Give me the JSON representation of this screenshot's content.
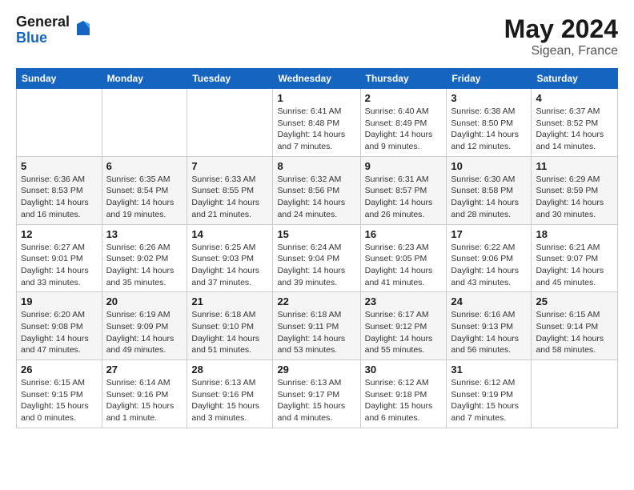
{
  "logo": {
    "general": "General",
    "blue": "Blue"
  },
  "header": {
    "month": "May 2024",
    "location": "Sigean, France"
  },
  "weekdays": [
    "Sunday",
    "Monday",
    "Tuesday",
    "Wednesday",
    "Thursday",
    "Friday",
    "Saturday"
  ],
  "weeks": [
    [
      {
        "day": "",
        "info": ""
      },
      {
        "day": "",
        "info": ""
      },
      {
        "day": "",
        "info": ""
      },
      {
        "day": "1",
        "info": "Sunrise: 6:41 AM\nSunset: 8:48 PM\nDaylight: 14 hours\nand 7 minutes."
      },
      {
        "day": "2",
        "info": "Sunrise: 6:40 AM\nSunset: 8:49 PM\nDaylight: 14 hours\nand 9 minutes."
      },
      {
        "day": "3",
        "info": "Sunrise: 6:38 AM\nSunset: 8:50 PM\nDaylight: 14 hours\nand 12 minutes."
      },
      {
        "day": "4",
        "info": "Sunrise: 6:37 AM\nSunset: 8:52 PM\nDaylight: 14 hours\nand 14 minutes."
      }
    ],
    [
      {
        "day": "5",
        "info": "Sunrise: 6:36 AM\nSunset: 8:53 PM\nDaylight: 14 hours\nand 16 minutes."
      },
      {
        "day": "6",
        "info": "Sunrise: 6:35 AM\nSunset: 8:54 PM\nDaylight: 14 hours\nand 19 minutes."
      },
      {
        "day": "7",
        "info": "Sunrise: 6:33 AM\nSunset: 8:55 PM\nDaylight: 14 hours\nand 21 minutes."
      },
      {
        "day": "8",
        "info": "Sunrise: 6:32 AM\nSunset: 8:56 PM\nDaylight: 14 hours\nand 24 minutes."
      },
      {
        "day": "9",
        "info": "Sunrise: 6:31 AM\nSunset: 8:57 PM\nDaylight: 14 hours\nand 26 minutes."
      },
      {
        "day": "10",
        "info": "Sunrise: 6:30 AM\nSunset: 8:58 PM\nDaylight: 14 hours\nand 28 minutes."
      },
      {
        "day": "11",
        "info": "Sunrise: 6:29 AM\nSunset: 8:59 PM\nDaylight: 14 hours\nand 30 minutes."
      }
    ],
    [
      {
        "day": "12",
        "info": "Sunrise: 6:27 AM\nSunset: 9:01 PM\nDaylight: 14 hours\nand 33 minutes."
      },
      {
        "day": "13",
        "info": "Sunrise: 6:26 AM\nSunset: 9:02 PM\nDaylight: 14 hours\nand 35 minutes."
      },
      {
        "day": "14",
        "info": "Sunrise: 6:25 AM\nSunset: 9:03 PM\nDaylight: 14 hours\nand 37 minutes."
      },
      {
        "day": "15",
        "info": "Sunrise: 6:24 AM\nSunset: 9:04 PM\nDaylight: 14 hours\nand 39 minutes."
      },
      {
        "day": "16",
        "info": "Sunrise: 6:23 AM\nSunset: 9:05 PM\nDaylight: 14 hours\nand 41 minutes."
      },
      {
        "day": "17",
        "info": "Sunrise: 6:22 AM\nSunset: 9:06 PM\nDaylight: 14 hours\nand 43 minutes."
      },
      {
        "day": "18",
        "info": "Sunrise: 6:21 AM\nSunset: 9:07 PM\nDaylight: 14 hours\nand 45 minutes."
      }
    ],
    [
      {
        "day": "19",
        "info": "Sunrise: 6:20 AM\nSunset: 9:08 PM\nDaylight: 14 hours\nand 47 minutes."
      },
      {
        "day": "20",
        "info": "Sunrise: 6:19 AM\nSunset: 9:09 PM\nDaylight: 14 hours\nand 49 minutes."
      },
      {
        "day": "21",
        "info": "Sunrise: 6:18 AM\nSunset: 9:10 PM\nDaylight: 14 hours\nand 51 minutes."
      },
      {
        "day": "22",
        "info": "Sunrise: 6:18 AM\nSunset: 9:11 PM\nDaylight: 14 hours\nand 53 minutes."
      },
      {
        "day": "23",
        "info": "Sunrise: 6:17 AM\nSunset: 9:12 PM\nDaylight: 14 hours\nand 55 minutes."
      },
      {
        "day": "24",
        "info": "Sunrise: 6:16 AM\nSunset: 9:13 PM\nDaylight: 14 hours\nand 56 minutes."
      },
      {
        "day": "25",
        "info": "Sunrise: 6:15 AM\nSunset: 9:14 PM\nDaylight: 14 hours\nand 58 minutes."
      }
    ],
    [
      {
        "day": "26",
        "info": "Sunrise: 6:15 AM\nSunset: 9:15 PM\nDaylight: 15 hours\nand 0 minutes."
      },
      {
        "day": "27",
        "info": "Sunrise: 6:14 AM\nSunset: 9:16 PM\nDaylight: 15 hours\nand 1 minute."
      },
      {
        "day": "28",
        "info": "Sunrise: 6:13 AM\nSunset: 9:16 PM\nDaylight: 15 hours\nand 3 minutes."
      },
      {
        "day": "29",
        "info": "Sunrise: 6:13 AM\nSunset: 9:17 PM\nDaylight: 15 hours\nand 4 minutes."
      },
      {
        "day": "30",
        "info": "Sunrise: 6:12 AM\nSunset: 9:18 PM\nDaylight: 15 hours\nand 6 minutes."
      },
      {
        "day": "31",
        "info": "Sunrise: 6:12 AM\nSunset: 9:19 PM\nDaylight: 15 hours\nand 7 minutes."
      },
      {
        "day": "",
        "info": ""
      }
    ]
  ]
}
